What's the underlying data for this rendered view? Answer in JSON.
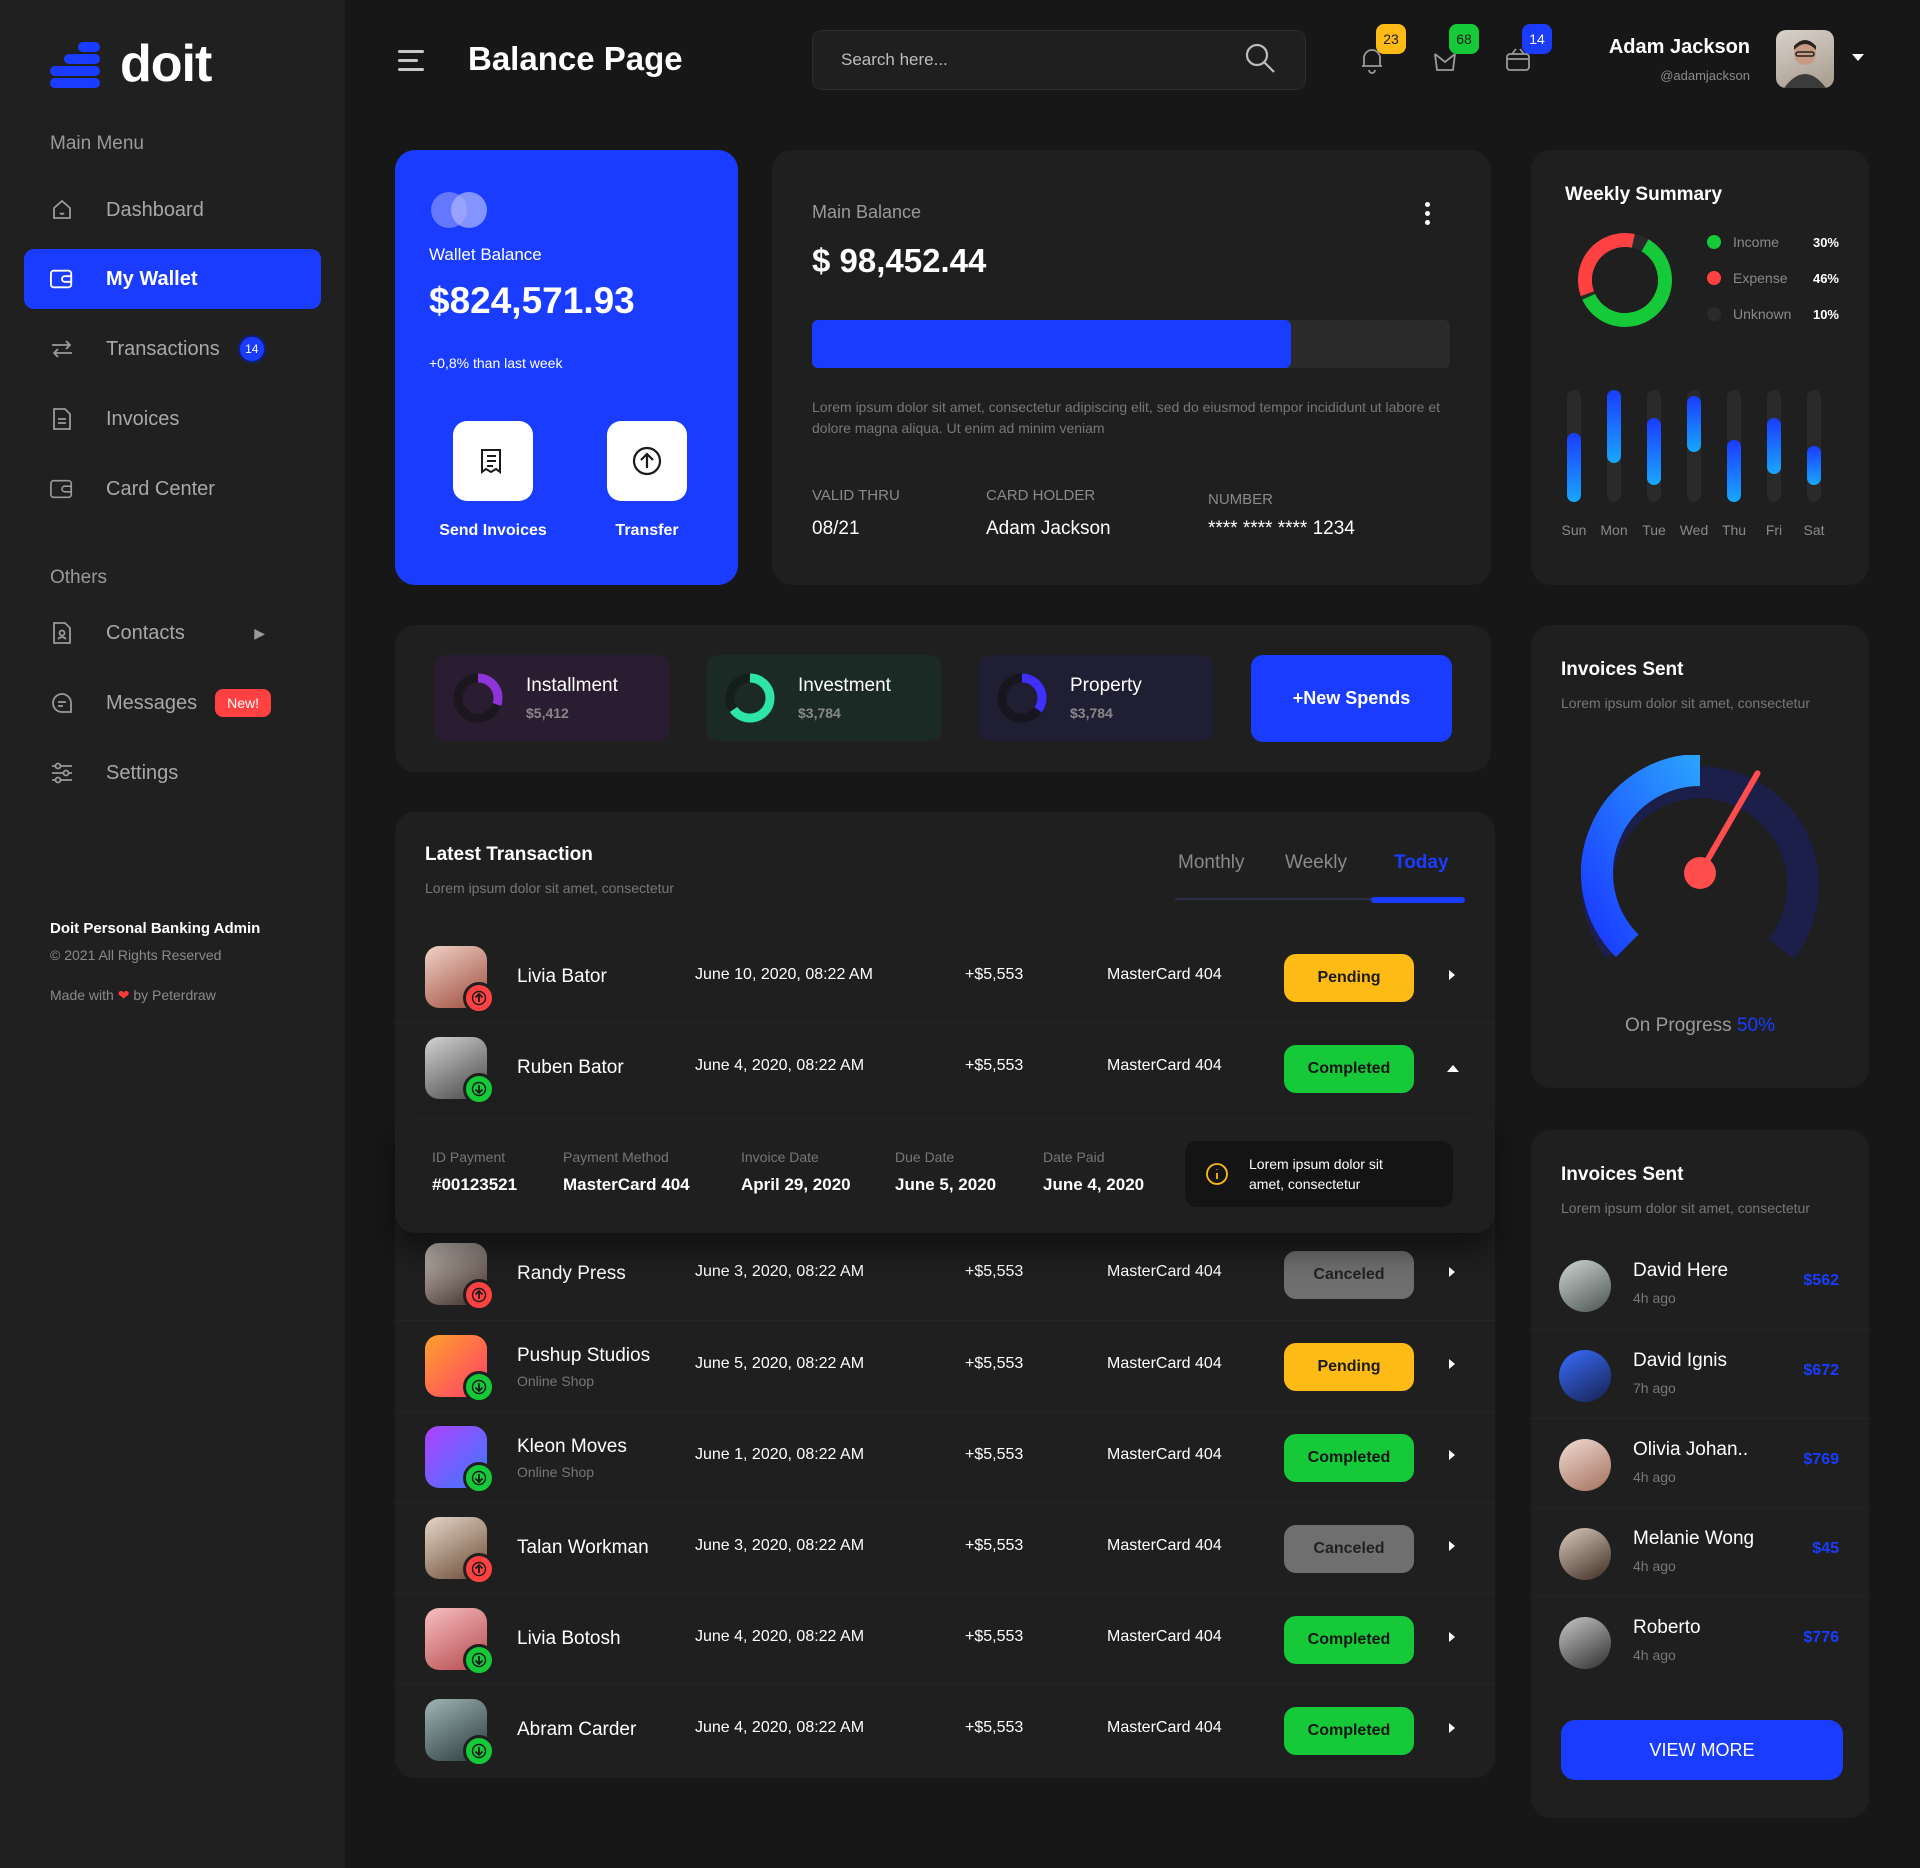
{
  "brand": {
    "name": "doit",
    "accent": "#1a3cff"
  },
  "sidebar": {
    "main_menu_title": "Main Menu",
    "items": [
      {
        "label": "Dashboard",
        "icon": "home-icon"
      },
      {
        "label": "My Wallet",
        "icon": "wallet-icon",
        "active": true
      },
      {
        "label": "Transactions",
        "icon": "transfer-icon",
        "badge": "14"
      },
      {
        "label": "Invoices",
        "icon": "document-icon"
      },
      {
        "label": "Card Center",
        "icon": "card-icon"
      }
    ],
    "others_title": "Others",
    "others": [
      {
        "label": "Contacts",
        "icon": "contacts-icon"
      },
      {
        "label": "Messages",
        "icon": "message-icon",
        "badge": "New!"
      },
      {
        "label": "Settings",
        "icon": "settings-icon"
      }
    ],
    "footer": {
      "title": "Doit Personal Banking Admin",
      "copyright": "© 2021 All Rights Reserved",
      "made_with_prefix": "Made with",
      "made_with_suffix": "by Peterdraw"
    }
  },
  "header": {
    "title": "Balance Page",
    "search_placeholder": "Search here...",
    "notifications": "23",
    "messages": "68",
    "cart": "14",
    "user_name": "Adam Jackson",
    "user_handle": "@adamjackson"
  },
  "wallet": {
    "label": "Wallet Balance",
    "amount": "$824,571.93",
    "change": "+0,8% than last week",
    "send_label": "Send Invoices",
    "transfer_label": "Transfer"
  },
  "main_balance": {
    "label": "Main Balance",
    "amount": "$ 98,452.44",
    "progress": 0.75,
    "description": "Lorem ipsum dolor sit amet, consectetur adipiscing elit, sed do eiusmod tempor incididunt ut labore et dolore magna aliqua. Ut enim ad minim veniam",
    "valid_thru_label": "VALID THRU",
    "valid_thru": "08/21",
    "holder_label": "CARD HOLDER",
    "holder": "Adam Jackson",
    "number_label": "NUMBER",
    "number": "**** **** **** 1234"
  },
  "weekly_summary": {
    "title": "Weekly Summary",
    "legend": [
      {
        "label": "Income",
        "pct": "30%",
        "color": "#15c938"
      },
      {
        "label": "Expense",
        "pct": "46%",
        "color": "#ff4141"
      },
      {
        "label": "Unknown",
        "pct": "10%",
        "color": "#2a2a2a"
      }
    ],
    "chart_data": {
      "type": "bar",
      "categories": [
        "Sun",
        "Mon",
        "Tue",
        "Wed",
        "Thu",
        "Fri",
        "Sat"
      ],
      "ranges": [
        [
          0.0,
          0.62
        ],
        [
          0.35,
          1.0
        ],
        [
          0.15,
          0.75
        ],
        [
          0.45,
          0.95
        ],
        [
          0.0,
          0.55
        ],
        [
          0.25,
          0.75
        ],
        [
          0.15,
          0.5
        ]
      ]
    }
  },
  "spends": [
    {
      "title": "Installment",
      "value": "$5,412",
      "bg": "#2b1d31",
      "color": "#8e34d9",
      "progress": 0.3
    },
    {
      "title": "Investment",
      "value": "$3,784",
      "bg": "#1b2a24",
      "color": "#2ee4a8",
      "progress": 0.65
    },
    {
      "title": "Property",
      "value": "$3,784",
      "bg": "#1f1e33",
      "color": "#3f30ff",
      "progress": 0.35
    }
  ],
  "new_spends_label": "+New Spends",
  "latest": {
    "title": "Latest Transaction",
    "subtitle": "Lorem ipsum dolor sit amet, consectetur",
    "tabs": [
      "Monthly",
      "Weekly",
      "Today"
    ],
    "rows": [
      {
        "name": "Livia Bator",
        "sub": "",
        "date": "June 10, 2020, 08:22 AM",
        "amount": "+$5,553",
        "card": "MasterCard 404",
        "status": "Pending",
        "dir": "out",
        "avatar": "linear-gradient(150deg,#f1d2c7,#9c4b3c)"
      },
      {
        "name": "Ruben Bator",
        "sub": "",
        "date": "June 4, 2020, 08:22 AM",
        "amount": "+$5,553",
        "card": "MasterCard 404",
        "status": "Completed",
        "dir": "in",
        "avatar": "linear-gradient(150deg,#d3d3d3,#454545)"
      },
      {
        "name": "Randy Press",
        "sub": "",
        "date": "June 3, 2020, 08:22 AM",
        "amount": "+$5,553",
        "card": "MasterCard 404",
        "status": "Canceled",
        "dir": "out",
        "avatar": "linear-gradient(150deg,#cfc6bf,#3b2b25)"
      },
      {
        "name": "Pushup Studios",
        "sub": "Online Shop",
        "date": "June 5, 2020, 08:22 AM",
        "amount": "+$5,553",
        "card": "MasterCard 404",
        "status": "Pending",
        "dir": "in",
        "avatar": "linear-gradient(135deg,#ffa12b,#ff3d6b)"
      },
      {
        "name": "Kleon Moves",
        "sub": "Online Shop",
        "date": "June 1, 2020, 08:22 AM",
        "amount": "+$5,553",
        "card": "MasterCard 404",
        "status": "Completed",
        "dir": "in",
        "avatar": "linear-gradient(135deg,#b041ff,#3a7bff)"
      },
      {
        "name": "Talan Workman",
        "sub": "",
        "date": "June 3, 2020, 08:22 AM",
        "amount": "+$5,553",
        "card": "MasterCard 404",
        "status": "Canceled",
        "dir": "out",
        "avatar": "linear-gradient(150deg,#e4d6c8,#6b4a34)"
      },
      {
        "name": "Livia Botosh",
        "sub": "",
        "date": "June 4, 2020, 08:22 AM",
        "amount": "+$5,553",
        "card": "MasterCard 404",
        "status": "Completed",
        "dir": "in",
        "avatar": "linear-gradient(150deg,#f7bfc0,#b5484d)"
      },
      {
        "name": "Abram Carder",
        "sub": "",
        "date": "June 4, 2020, 08:22 AM",
        "amount": "+$5,553",
        "card": "MasterCard 404",
        "status": "Completed",
        "dir": "in",
        "avatar": "linear-gradient(150deg,#9fb4b5,#2a3a3c)"
      }
    ],
    "detail": {
      "id_label": "ID Payment",
      "id": "#00123521",
      "method_label": "Payment Method",
      "method": "MasterCard 404",
      "invoice_label": "Invoice Date",
      "invoice": "April 29, 2020",
      "due_label": "Due Date",
      "due": "June 5, 2020",
      "paid_label": "Date Paid",
      "paid": "June 4, 2020",
      "note": "Lorem ipsum dolor sit amet, consectetur"
    }
  },
  "invoices_gauge": {
    "title": "Invoices Sent",
    "subtitle": "Lorem ipsum dolor sit amet, consectetur",
    "label": "On Progress",
    "value_text": "50%",
    "value": 0.5
  },
  "invoices_list": {
    "title": "Invoices Sent",
    "subtitle": "Lorem ipsum dolor sit amet, consectetur",
    "people": [
      {
        "name": "David Here",
        "time": "4h ago",
        "amount": "$562",
        "avatar": "linear-gradient(150deg,#cdd6d2,#4b5450)"
      },
      {
        "name": "David Ignis",
        "time": "7h ago",
        "amount": "$672",
        "avatar": "linear-gradient(150deg,#3a6cff,#16224f)"
      },
      {
        "name": "Olivia Johan..",
        "time": "4h ago",
        "amount": "$769",
        "avatar": "linear-gradient(150deg,#f1dcd4,#a3705d)"
      },
      {
        "name": "Melanie Wong",
        "time": "4h ago",
        "amount": "$45",
        "avatar": "linear-gradient(150deg,#d9cabe,#3d2c22)"
      },
      {
        "name": "Roberto",
        "time": "4h ago",
        "amount": "$776",
        "avatar": "linear-gradient(150deg,#c7c7c7,#2f2f2f)"
      }
    ],
    "view_more": "VIEW MORE"
  }
}
